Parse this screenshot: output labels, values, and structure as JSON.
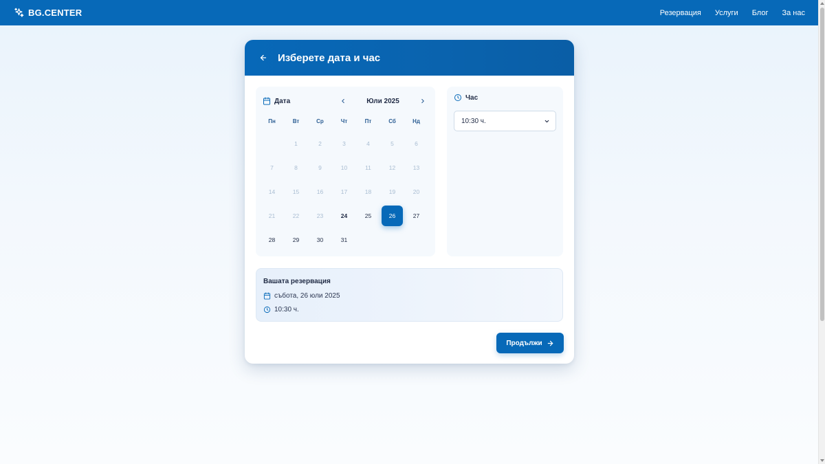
{
  "header": {
    "brand": "BG.CENTER",
    "nav": [
      "Резервация",
      "Услуги",
      "Блог",
      "За нас"
    ]
  },
  "card": {
    "title": "Изберете дата и час"
  },
  "calendar": {
    "label": "Дата",
    "month": "Юли 2025",
    "weekdays": [
      "Пн",
      "Вт",
      "Ср",
      "Чт",
      "Пт",
      "Сб",
      "Нд"
    ],
    "leading_blanks": 1,
    "days_in_month": 31,
    "first_available": 24,
    "today": 24,
    "selected": 26
  },
  "time": {
    "label": "Час",
    "selected": "10:30 ч."
  },
  "summary": {
    "title": "Вашата резервация",
    "date": "събота, 26 юли 2025",
    "time": "10:30 ч."
  },
  "actions": {
    "continue_label": "Продължи"
  },
  "colors": {
    "primary": "#0769b8",
    "disabled_day": "#a9bdd2",
    "text": "#1f2a44"
  }
}
